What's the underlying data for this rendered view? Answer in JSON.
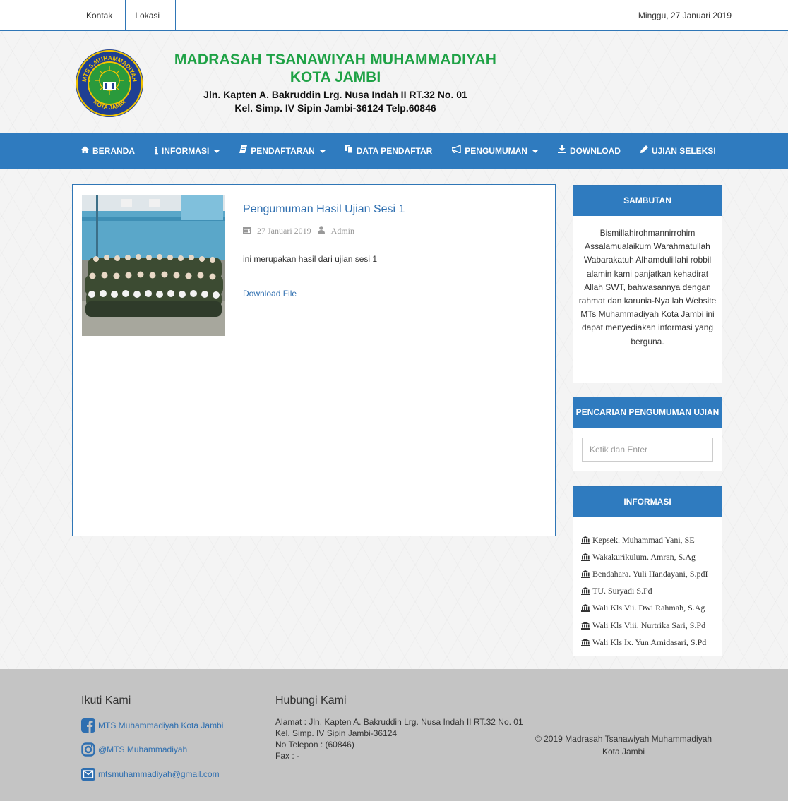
{
  "topbar": {
    "links": [
      "Kontak",
      "Lokasi"
    ],
    "date": "Minggu, 27 Januari 2019"
  },
  "header": {
    "name_line1": "MADRASAH TSANAWIYAH MUHAMMADIYAH",
    "name_line2": "KOTA JAMBI",
    "address_line1": "Jln. Kapten A. Bakruddin Lrg. Nusa Indah II RT.32 No. 01",
    "address_line2": "Kel. Simp. IV Sipin Jambi-36124 Telp.60846",
    "logo_text_top": "MTS S.MUHAMMADIYAH",
    "logo_text_bottom": "KOTA JAMBI"
  },
  "navbar": {
    "items": [
      {
        "label": "BERANDA",
        "icon": "home-icon",
        "dropdown": false
      },
      {
        "label": "INFORMASI",
        "icon": "info-icon",
        "dropdown": true
      },
      {
        "label": "PENDAFTARAN",
        "icon": "book-icon",
        "dropdown": true
      },
      {
        "label": "DATA PENDAFTAR",
        "icon": "copy-icon",
        "dropdown": false
      },
      {
        "label": "PENGUMUMAN",
        "icon": "bullhorn-icon",
        "dropdown": true
      },
      {
        "label": "DOWNLOAD",
        "icon": "download-icon",
        "dropdown": false
      },
      {
        "label": "UJIAN SELEKSI",
        "icon": "pencil-icon",
        "dropdown": false
      }
    ]
  },
  "post": {
    "title": "Pengumuman Hasil Ujian Sesi 1",
    "date": "27 Januari 2019",
    "author": "Admin",
    "text": "ini merupakan hasil dari ujian sesi 1",
    "download_label": "Download File"
  },
  "sidebar": {
    "sambutan": {
      "title": "SAMBUTAN",
      "text": "Bismillahirohmannirrohim Assalamualaikum Warahmatullah Wabarakatuh Alhamdulillahi robbil alamin kami panjatkan kehadirat Allah SWT, bahwasannya dengan rahmat dan karunia-Nya lah Website MTs Muhammadiyah Kota Jambi ini dapat menyediakan informasi yang berguna."
    },
    "search": {
      "title": "PENCARIAN PENGUMUMAN UJIAN",
      "placeholder": "Ketik dan Enter"
    },
    "informasi": {
      "title": "INFORMASI",
      "items": [
        "Kepsek. Muhammad Yani, SE",
        "Wakakurikulum. Amran, S.Ag",
        "Bendahara. Yuli Handayani, S.pdI",
        "TU. Suryadi S.Pd",
        "Wali Kls Vii. Dwi Rahmah, S.Ag",
        "Wali Kls Viii. Nurtrika Sari, S.Pd",
        "Wali Kls Ix. Yun Arnidasari, S.Pd"
      ]
    }
  },
  "footer": {
    "follow_title": "Ikuti Kami",
    "facebook": "MTS Muhammadiyah Kota Jambi",
    "instagram": "@MTS Muhammadiyah",
    "email": "mtsmuhammadiyah@gmail.com",
    "contact_title": "Hubungi Kami",
    "address1": "Alamat : Jln. Kapten A. Bakruddin Lrg. Nusa Indah II RT.32 No. 01",
    "address2": "Kel. Simp. IV Sipin Jambi-36124",
    "phone": "No Telepon : (60846)",
    "fax": "Fax : -",
    "copyright_line1": "© 2019 Madrasah Tsanawiyah Muhammadiyah",
    "copyright_line2": "Kota Jambi"
  },
  "colors": {
    "brand_blue": "#2f7bbf",
    "school_green": "#1fa246",
    "link_blue": "#2f6fb0",
    "footer_gray": "#c4c4c4"
  }
}
